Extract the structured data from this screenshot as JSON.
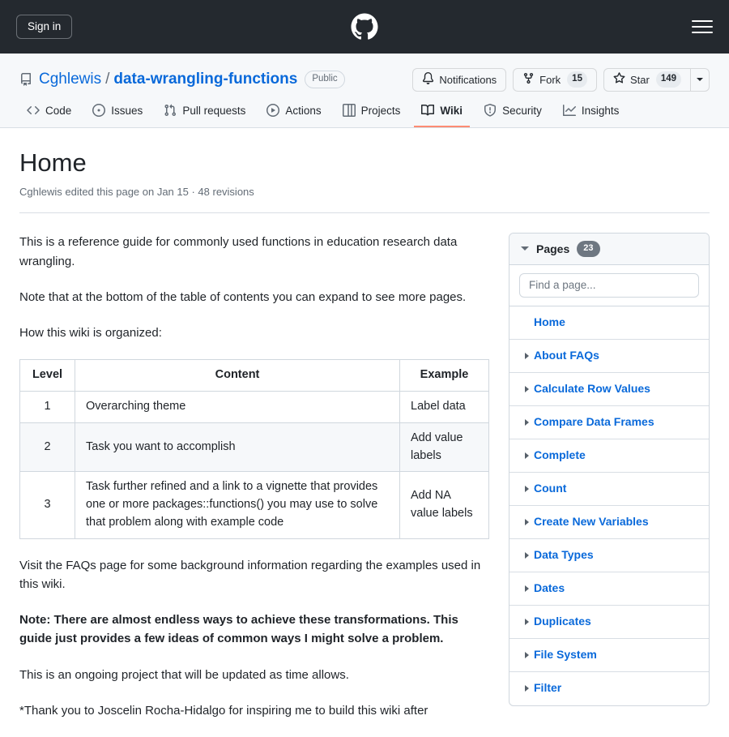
{
  "topbar": {
    "signin_label": "Sign in",
    "logo_icon": "github-mark-icon",
    "menu_icon": "hamburger-menu-icon"
  },
  "repo": {
    "repo_icon": "repo-book-icon",
    "owner": "Cghlewis",
    "separator": "/",
    "name": "data-wrangling-functions",
    "visibility": "Public",
    "actions": {
      "notifications_label": "Notifications",
      "notifications_icon": "bell-icon",
      "fork_label": "Fork",
      "fork_icon": "repo-forked-icon",
      "fork_count": "15",
      "star_label": "Star",
      "star_icon": "star-icon",
      "star_count": "149",
      "dropdown_icon": "caret-down-icon"
    },
    "nav_tabs": [
      {
        "label": "Code",
        "icon": "code-icon",
        "active": false
      },
      {
        "label": "Issues",
        "icon": "issue-opened-icon",
        "active": false
      },
      {
        "label": "Pull requests",
        "icon": "git-pull-request-icon",
        "active": false
      },
      {
        "label": "Actions",
        "icon": "play-circle-icon",
        "active": false
      },
      {
        "label": "Projects",
        "icon": "table-projects-icon",
        "active": false
      },
      {
        "label": "Wiki",
        "icon": "book-icon",
        "active": true
      },
      {
        "label": "Security",
        "icon": "shield-icon",
        "active": false
      },
      {
        "label": "Insights",
        "icon": "graph-icon",
        "active": false
      }
    ]
  },
  "wiki": {
    "title": "Home",
    "meta": "Cghlewis edited this page on Jan 15 · 48 revisions",
    "paragraphs": {
      "p1": "This is a reference guide for commonly used functions in education research data wrangling.",
      "p2": "Note that at the bottom of the table of contents you can expand to see more pages.",
      "p3": "How this wiki is organized:",
      "p4": "Visit the FAQs page for some background information regarding the examples used in this wiki.",
      "p5": "Note: There are almost endless ways to achieve these transformations. This guide just provides a few ideas of common ways I might solve a problem.",
      "p6": "This is an ongoing project that will be updated as time allows.",
      "p7": "*Thank you to Joscelin Rocha-Hidalgo for inspiring me to build this wiki after"
    },
    "table": {
      "headers": [
        "Level",
        "Content",
        "Example"
      ],
      "rows": [
        [
          "1",
          "Overarching theme",
          "Label data"
        ],
        [
          "2",
          "Task you want to accomplish",
          "Add value labels"
        ],
        [
          "3",
          "Task further refined and a link to a vignette that provides one or more packages::functions() you may use to solve that problem along with example code",
          "Add NA value labels"
        ]
      ]
    }
  },
  "sidebar": {
    "header_label": "Pages",
    "header_count": "23",
    "collapse_icon": "triangle-down-icon",
    "search_placeholder": "Find a page...",
    "search_value": "",
    "items": [
      {
        "label": "Home",
        "expandable": false
      },
      {
        "label": "About FAQs",
        "expandable": true
      },
      {
        "label": "Calculate Row Values",
        "expandable": true
      },
      {
        "label": "Compare Data Frames",
        "expandable": true
      },
      {
        "label": "Complete",
        "expandable": true
      },
      {
        "label": "Count",
        "expandable": true
      },
      {
        "label": "Create New Variables",
        "expandable": true
      },
      {
        "label": "Data Types",
        "expandable": true
      },
      {
        "label": "Dates",
        "expandable": true
      },
      {
        "label": "Duplicates",
        "expandable": true
      },
      {
        "label": "File System",
        "expandable": true
      },
      {
        "label": "Filter",
        "expandable": true
      }
    ]
  },
  "colors": {
    "header_bg": "#24292f",
    "link_blue": "#0969da",
    "active_tab_underline": "#fd8c73",
    "subtle_bg": "#f6f8fa",
    "border": "#d0d7de",
    "badge_bg": "#6e7781"
  }
}
